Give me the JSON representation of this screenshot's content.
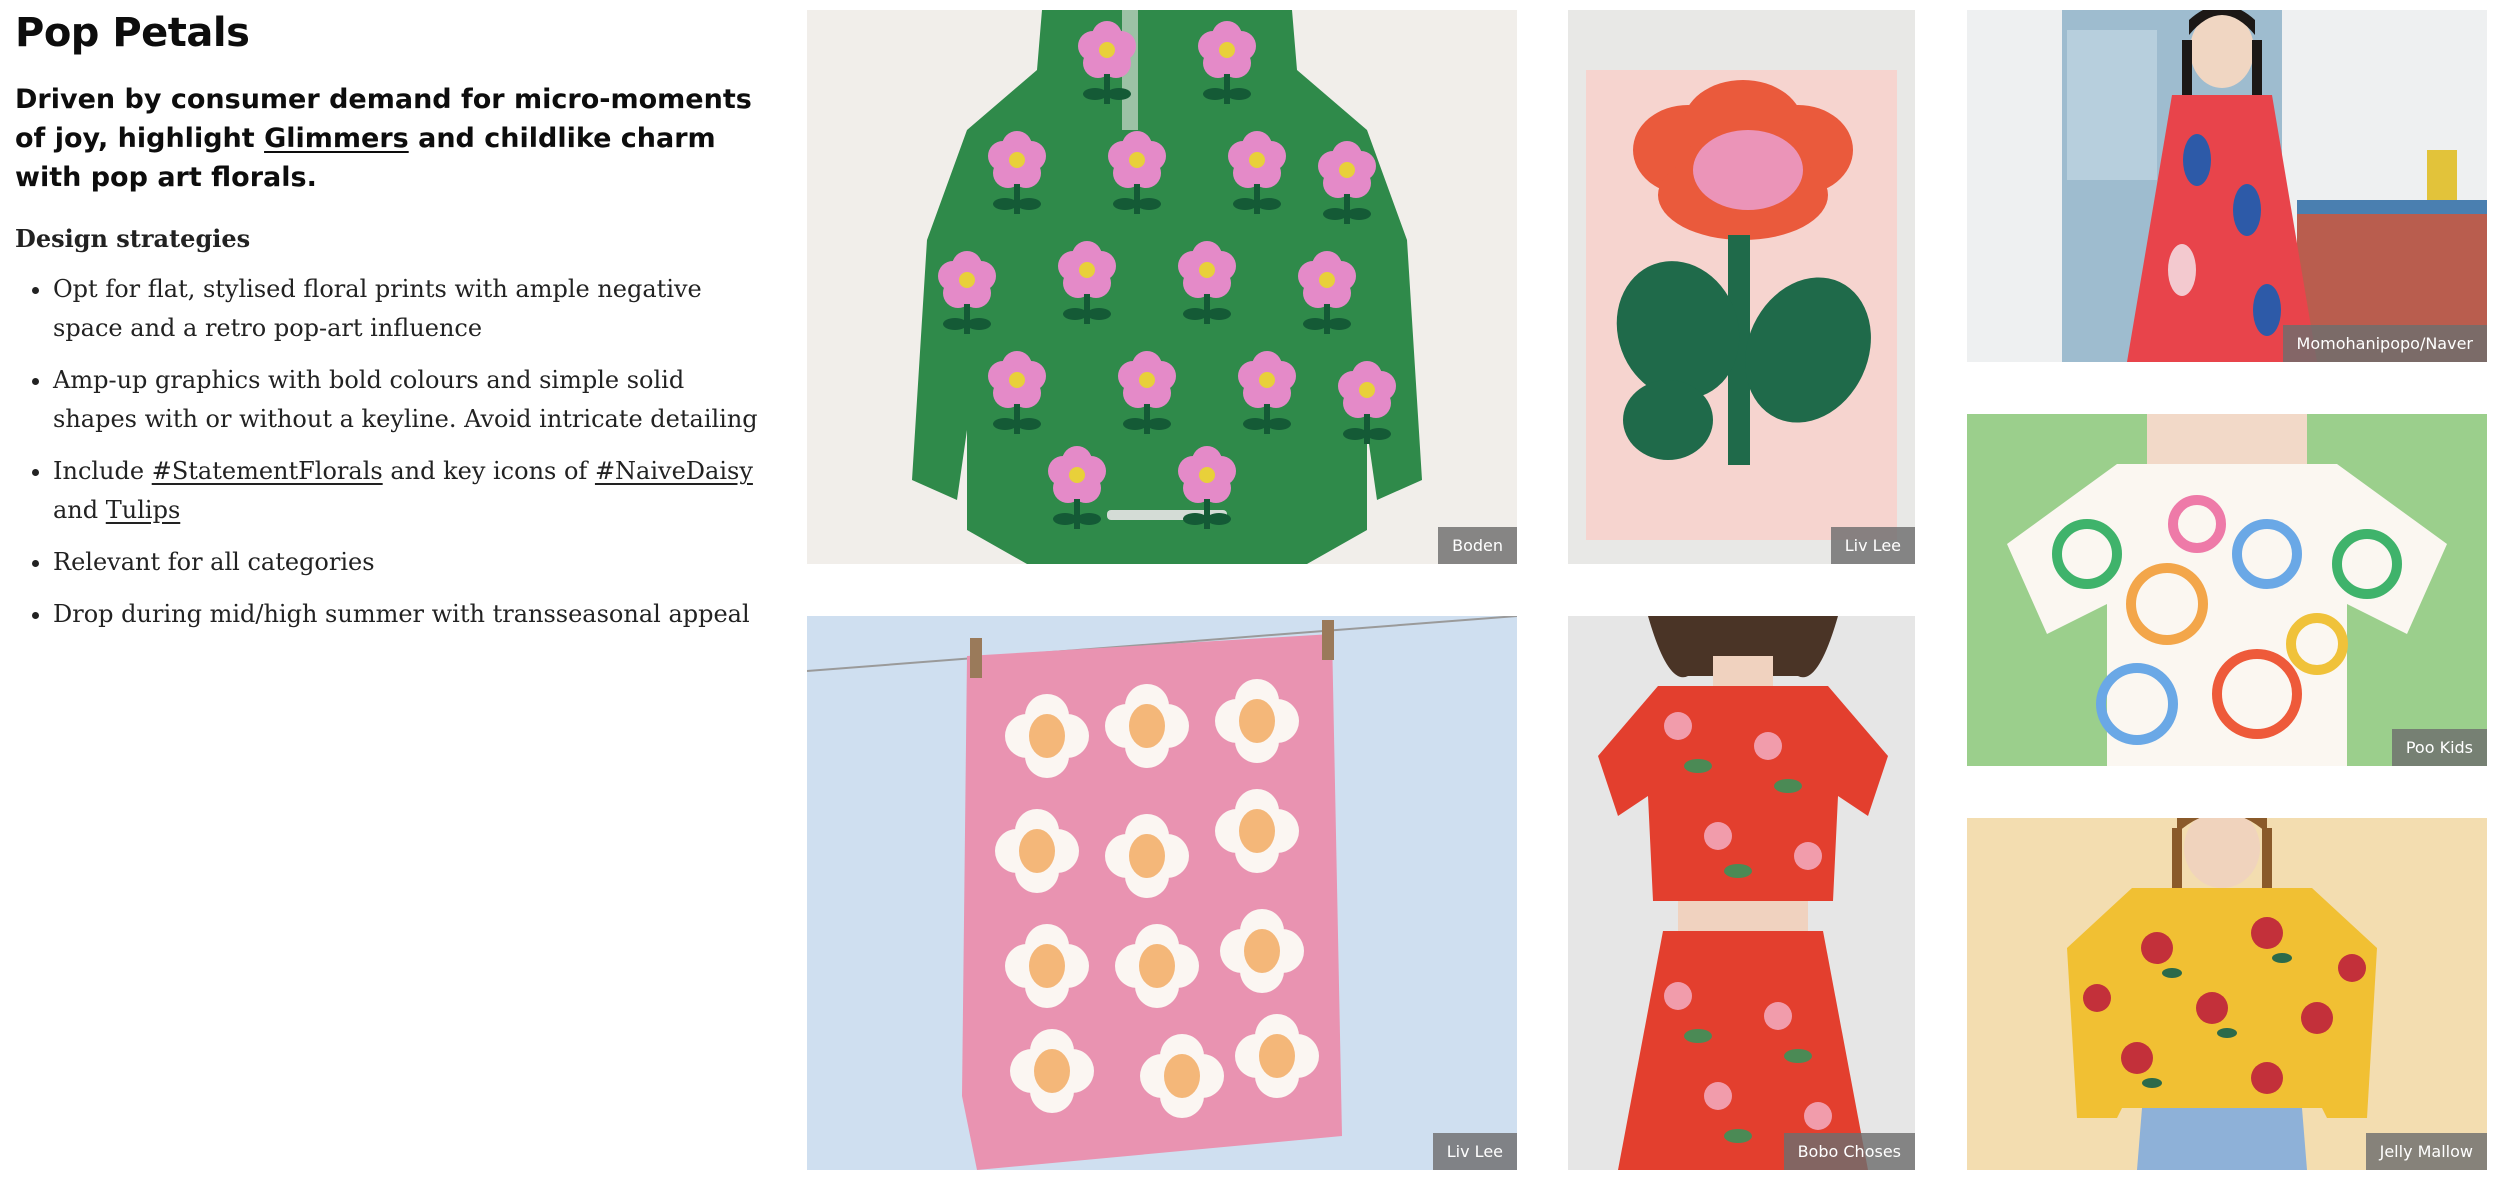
{
  "page": {
    "title": "Pop Petals",
    "lede_part1": "Driven by consumer demand for micro-moments of joy, highlight ",
    "lede_link": "Glimmers",
    "lede_part2": " and childlike charm with pop art florals.",
    "subheading": "Design strategies"
  },
  "bullets": [
    {
      "text": "Opt for flat, stylised floral prints with ample negative space and a retro pop-art influence"
    },
    {
      "text": "Amp-up graphics with bold colours and simple solid shapes with or without a keyline. Avoid intricate detailing"
    },
    {
      "pre": "Include ",
      "link1": "#StatementFlorals",
      "mid": " and key icons of ",
      "link2": "#NaiveDaisy",
      "mid2": " and ",
      "link3": "Tulips"
    },
    {
      "text": "Relevant for all categories"
    },
    {
      "text": "Drop during mid/high summer with transseasonal appeal"
    }
  ],
  "gallery": [
    {
      "credit": "Boden",
      "subject": "green hooded raincoat with pink flowers"
    },
    {
      "credit": "Liv Lee",
      "subject": "red flower print on pink card"
    },
    {
      "credit": "Momohanipopo/Naver",
      "subject": "girl in red tulip print dress"
    },
    {
      "credit": "Poo Kids",
      "subject": "multicolour outline flower top"
    },
    {
      "credit": "Liv Lee",
      "subject": "pink daisy tea towel on line"
    },
    {
      "credit": "Bobo Choses",
      "subject": "red floral crop top and skirt"
    },
    {
      "credit": "Jelly Mallow",
      "subject": "yellow sweater with red flowers"
    }
  ],
  "colors": {
    "text": "#0d0d0d",
    "credit_bg": "#6e6e6e",
    "jacket_green": "#2f8a4a",
    "flower_pink": "#e48ac8",
    "poster_red": "#ea5a3c",
    "poster_green": "#1f6a4a"
  }
}
